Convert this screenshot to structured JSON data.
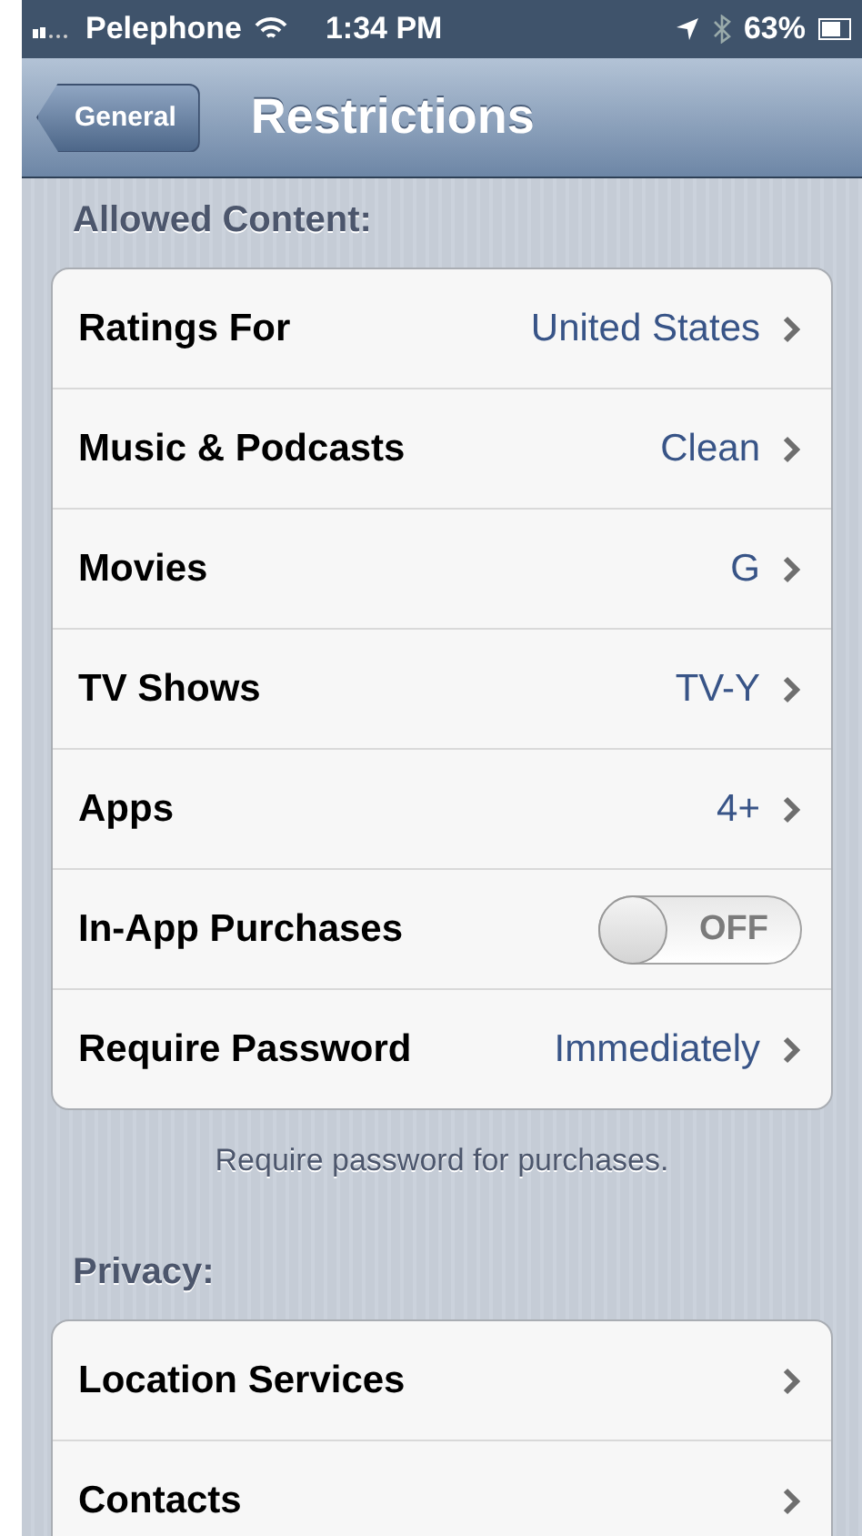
{
  "status_bar": {
    "carrier": "Pelephone",
    "time": "1:34 PM",
    "battery": "63%"
  },
  "nav_bar": {
    "back": "General",
    "title": "Restrictions"
  },
  "sections": [
    {
      "header": "Allowed Content:",
      "footer": "Require password for purchases.",
      "rows": [
        {
          "kind": "value",
          "label": "Ratings For",
          "value": "United States"
        },
        {
          "kind": "value",
          "label": "Music & Podcasts",
          "value": "Clean"
        },
        {
          "kind": "value",
          "label": "Movies",
          "value": "G"
        },
        {
          "kind": "value",
          "label": "TV Shows",
          "value": "TV-Y"
        },
        {
          "kind": "value",
          "label": "Apps",
          "value": "4+"
        },
        {
          "kind": "switch",
          "label": "In-App Purchases",
          "on": false,
          "switch_text": "OFF"
        },
        {
          "kind": "value",
          "label": "Require Password",
          "value": "Immediately"
        }
      ]
    },
    {
      "header": "Privacy:",
      "rows": [
        {
          "kind": "link",
          "label": "Location Services"
        },
        {
          "kind": "link",
          "label": "Contacts"
        }
      ]
    }
  ]
}
